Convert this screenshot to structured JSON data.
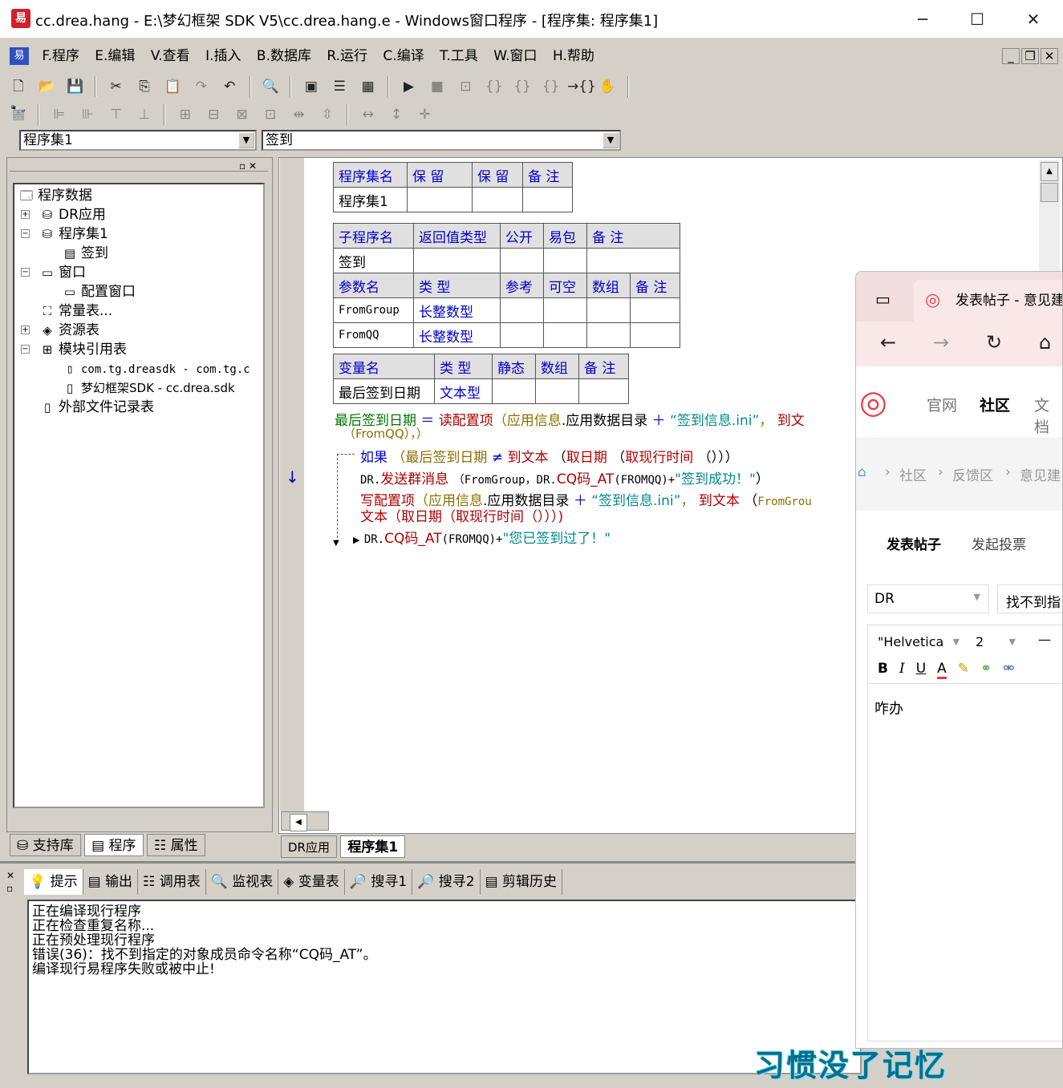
{
  "window": {
    "title": "cc.drea.hang - E:\\梦幻框架 SDK V5\\cc.drea.hang.e - Windows窗口程序 - [程序集: 程序集1]",
    "minimize": "─",
    "maximize": "☐",
    "close": "✕"
  },
  "menu": [
    "F.程序",
    "E.编辑",
    "V.查看",
    "I.插入",
    "B.数据库",
    "R.运行",
    "C.编译",
    "T.工具",
    "W.窗口",
    "H.帮助"
  ],
  "combo": {
    "left": "程序集1",
    "right": "签到"
  },
  "tree": {
    "root": "程序数据",
    "dr": "DR应用",
    "set": "程序集1",
    "signin": "签到",
    "window": "窗口",
    "config": "配置窗口",
    "const": "常量表...",
    "res": "资源表",
    "mod": "模块引用表",
    "mod1": "com.tg.dreasdk - com.tg.c",
    "mod2": "梦幻框架SDK - cc.drea.sdk",
    "ext": "外部文件记录表"
  },
  "left_tabs": [
    "支持库",
    "程序",
    "属性"
  ],
  "table1": {
    "headers": [
      "程序集名",
      "保 留",
      "保 留",
      "备 注"
    ],
    "row": [
      "程序集1",
      "",
      "",
      ""
    ]
  },
  "table2": {
    "headers": [
      "子程序名",
      "返回值类型",
      "公开",
      "易包",
      "备 注"
    ],
    "row": [
      "签到",
      "",
      "",
      "",
      ""
    ],
    "pheaders": [
      "参数名",
      "类 型",
      "参考",
      "可空",
      "数组",
      "备 注"
    ],
    "params": [
      [
        "FromGroup",
        "长整数型"
      ],
      [
        "FromQQ",
        "长整数型"
      ]
    ]
  },
  "table3": {
    "headers": [
      "变量名",
      "类 型",
      "静态",
      "数组",
      "备 注"
    ],
    "row": [
      "最后签到日期",
      "文本型",
      "",
      "",
      ""
    ]
  },
  "code": {
    "l1a": "最后签到日期",
    "l1b": "＝",
    "l1c": "读配置项",
    "l1d": "（",
    "l1e": "应用信息",
    "l1f": ".应用数据目录",
    "l1g": "＋",
    "l1h": "“签到信息.ini”",
    "l1i": "，",
    "l1j": "到文",
    "l2": "（FromQQ），）",
    "l3a": "如果",
    "l3b": "（",
    "l3c": "最后签到日期",
    "l3d": "≠",
    "l3e": "到文本",
    "l3f": "（",
    "l3g": "取日期",
    "l3h": "（",
    "l3i": "取现行时间",
    "l3j": "（）））",
    "l4a": "DR.",
    "l4b": "发送群消息",
    "l4c": "（FromGroup，DR.",
    "l4d": "CQ码_AT",
    "l4e": "(FROMQQ)+",
    "l4f": "\"签到成功！\"",
    "l4g": "）",
    "l5a": "写配置项",
    "l5b": "（",
    "l5c": "应用信息",
    "l5d": ".应用数据目录",
    "l5e": "＋",
    "l5f": "“签到信息.ini”",
    "l5g": "，",
    "l5h": "到文本",
    "l5i": "（",
    "l5j": "FromGrou",
    "l6": "文本（取日期（取现行时间（）））)",
    "l7a": "DR.",
    "l7b": "CQ码_AT",
    "l7c": "(FROMQQ)+",
    "l7d": "\"您已签到过了！\""
  },
  "editor_tabs": [
    "DR应用",
    "程序集1"
  ],
  "output_tabs": [
    "提示",
    "输出",
    "调用表",
    "监视表",
    "变量表",
    "搜寻1",
    "搜寻2",
    "剪辑历史"
  ],
  "output_lines": [
    "正在编译现行程序",
    "正在检查重复名称...",
    "正在预处理现行程序",
    "错误(36)：找不到指定的对象成员命令名称“CQ码_AT”。",
    "编译现行易程序失败或被中止!"
  ],
  "browser": {
    "tab_title": "发表帖子 - 意见建",
    "site_nav": [
      "官网",
      "社区",
      "文档"
    ],
    "breadcrumb": [
      "社区",
      "反馈区",
      "意见建"
    ],
    "post_tabs": [
      "发表帖子",
      "发起投票"
    ],
    "select1": "DR",
    "select2": "找不到指",
    "font": "\"Helvetica",
    "size": "2",
    "content": "咋办"
  },
  "watermark": "习惯没了记忆"
}
